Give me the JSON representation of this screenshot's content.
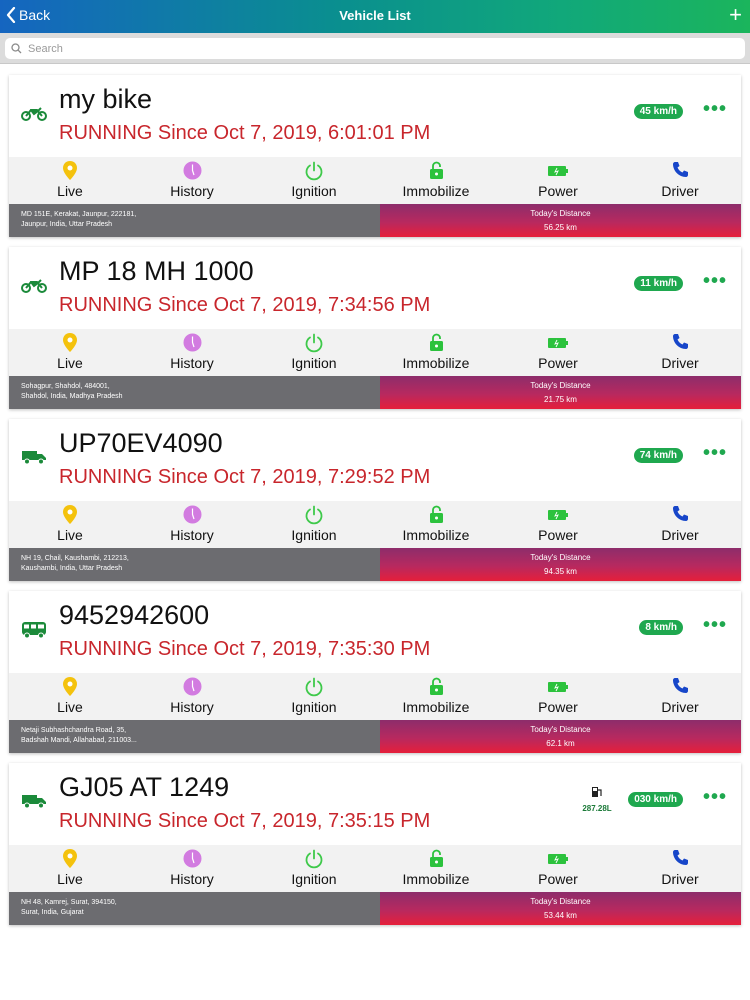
{
  "navbar": {
    "back_label": "Back",
    "title": "Vehicle List",
    "add_label": "+"
  },
  "search": {
    "placeholder": "Search"
  },
  "actions": [
    "Live",
    "History",
    "Ignition",
    "Immobilize",
    "Power",
    "Driver"
  ],
  "colors": {
    "running": "#c8262c",
    "accent_green": "#1fa84f",
    "live": "#f4c20d",
    "history": "#d27be0",
    "ignition": "#3ec94a",
    "driver": "#1746c9"
  },
  "vehicles": [
    {
      "name": "my bike",
      "icon": "motorbike-icon",
      "status": "RUNNING Since Oct 7, 2019, 6:01:01 PM",
      "speed": "45 km/h",
      "fuel": "",
      "address_line1": "MD 151E, Kerakat, Jaunpur, 222181,",
      "address_line2": "Jaunpur, India, Uttar Pradesh",
      "distance_label": "Today's Distance",
      "distance": "56.25 km"
    },
    {
      "name": "MP 18 MH 1000",
      "icon": "motorbike-icon",
      "status": "RUNNING Since Oct 7, 2019, 7:34:56 PM",
      "speed": "11 km/h",
      "fuel": "",
      "address_line1": "Sohagpur, Shahdol, 484001,",
      "address_line2": "Shahdol, India, Madhya Pradesh",
      "distance_label": "Today's Distance",
      "distance": "21.75 km"
    },
    {
      "name": "UP70EV4090",
      "icon": "truck-icon",
      "status": "RUNNING Since Oct 7, 2019, 7:29:52 PM",
      "speed": "74 km/h",
      "fuel": "",
      "address_line1": "NH 19, Chail, Kaushambi, 212213,",
      "address_line2": "Kaushambi, India, Uttar Pradesh",
      "distance_label": "Today's Distance",
      "distance": "94.35 km"
    },
    {
      "name": "9452942600",
      "icon": "bus-icon",
      "status": "RUNNING Since Oct 7, 2019, 7:35:30 PM",
      "speed": "8 km/h",
      "fuel": "",
      "address_line1": "Netaji Subhashchandra Road, 35,",
      "address_line2": "Badshah Mandi, Allahabad, 211003...",
      "distance_label": "Today's Distance",
      "distance": "62.1 km"
    },
    {
      "name": "GJ05 AT 1249",
      "icon": "truck-icon",
      "status": "RUNNING Since Oct 7, 2019, 7:35:15 PM",
      "speed": "030 km/h",
      "fuel": "287.28L",
      "address_line1": "NH 48, Kamrej, Surat, 394150,",
      "address_line2": "Surat, India, Gujarat",
      "distance_label": "Today's Distance",
      "distance": "53.44 km"
    }
  ]
}
